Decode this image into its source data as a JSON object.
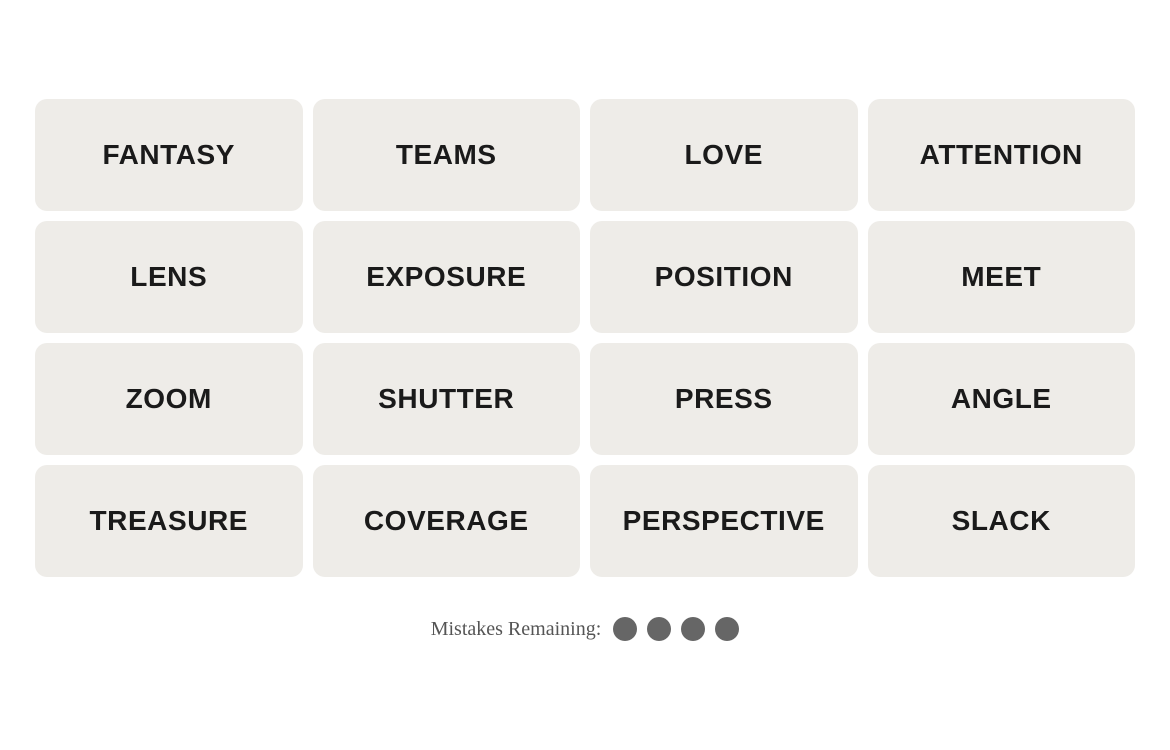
{
  "grid": {
    "tiles": [
      {
        "id": "fantasy",
        "label": "FANTASY"
      },
      {
        "id": "teams",
        "label": "TEAMS"
      },
      {
        "id": "love",
        "label": "LOVE"
      },
      {
        "id": "attention",
        "label": "ATTENTION"
      },
      {
        "id": "lens",
        "label": "LENS"
      },
      {
        "id": "exposure",
        "label": "EXPOSURE"
      },
      {
        "id": "position",
        "label": "POSITION"
      },
      {
        "id": "meet",
        "label": "MEET"
      },
      {
        "id": "zoom",
        "label": "ZOOM"
      },
      {
        "id": "shutter",
        "label": "SHUTTER"
      },
      {
        "id": "press",
        "label": "PRESS"
      },
      {
        "id": "angle",
        "label": "ANGLE"
      },
      {
        "id": "treasure",
        "label": "TREASURE"
      },
      {
        "id": "coverage",
        "label": "COVERAGE"
      },
      {
        "id": "perspective",
        "label": "PERSPECTIVE"
      },
      {
        "id": "slack",
        "label": "SLACK"
      }
    ]
  },
  "footer": {
    "mistakes_label": "Mistakes Remaining:",
    "dots_count": 4
  }
}
